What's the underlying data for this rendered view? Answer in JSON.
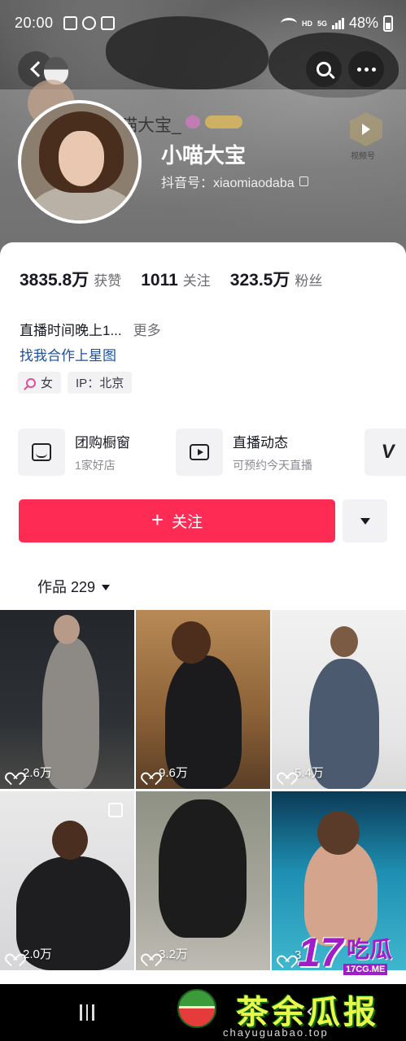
{
  "status_bar": {
    "time": "20:00",
    "network": "HD",
    "network2": "5G",
    "battery": "48%"
  },
  "header": {
    "ghost_name": "喵大宝_",
    "video_badge_label": "视频号"
  },
  "profile": {
    "name": "小喵大宝",
    "douyin_id": "抖音号：xiaomiaodaba"
  },
  "stats": [
    {
      "value": "3835.8万",
      "label": "获赞"
    },
    {
      "value": "1011",
      "label": "关注"
    },
    {
      "value": "323.5万",
      "label": "粉丝"
    }
  ],
  "bio": {
    "text": "直播时间晚上1...",
    "more": "更多",
    "link": "找我合作上星图"
  },
  "tags": [
    {
      "text": "女",
      "icon": "female-icon"
    },
    {
      "text": "IP：北京"
    }
  ],
  "entries": [
    {
      "title": "团购橱窗",
      "sub": "1家好店",
      "icon": "shop-icon"
    },
    {
      "title": "直播动态",
      "sub": "可预约今天直播",
      "icon": "tv-icon"
    },
    {
      "title": "",
      "sub": "",
      "icon": "v-icon"
    }
  ],
  "actions": {
    "follow": "关注",
    "follow_icon": "+"
  },
  "works_tab": {
    "label": "作品 229"
  },
  "grid": [
    {
      "likes": "2.6万"
    },
    {
      "likes": "9.6万"
    },
    {
      "likes": "5.4万"
    },
    {
      "likes": "2.0万"
    },
    {
      "likes": "3.2万"
    },
    {
      "likes": "3"
    }
  ],
  "watermarks": {
    "num": "17",
    "chars": "吃瓜",
    "domain17": "17CG.ME",
    "tea_text": "茶余瓜报",
    "tea_domain": "chayuguabao.top"
  },
  "colors": {
    "accent": "#fe2c55",
    "link": "#1d4f9e",
    "wm_purple": "#a01ec8"
  }
}
